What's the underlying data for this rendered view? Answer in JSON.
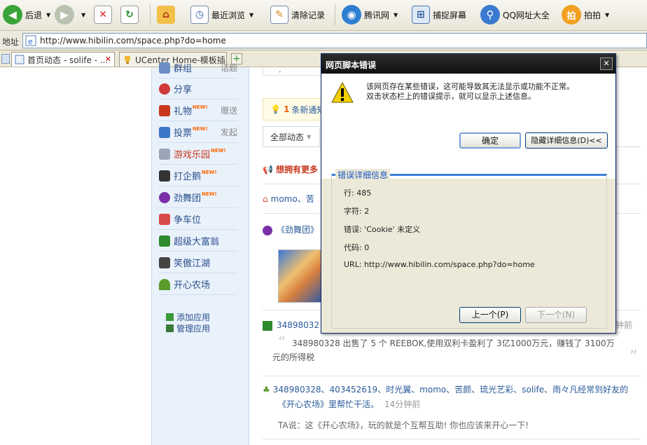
{
  "toolbar": {
    "back": "后退",
    "recent": "最近浏览",
    "clear": "清除记录",
    "tencent": "腾讯网",
    "capture": "捕捉屏幕",
    "qq_urls": "QQ网址大全",
    "paipai": "拍拍"
  },
  "address": {
    "label": "地址",
    "url": "http://www.hibilin.com/space.php?do=home"
  },
  "tabs": [
    {
      "title": "首页动态 - solife - ..."
    },
    {
      "title": "UCenter Home-模板插..."
    }
  ],
  "sidebar": {
    "items": [
      {
        "label": "群组",
        "side": "话题",
        "new": "",
        "color": "#2a4e8a",
        "icon_color": "#6b8fc4"
      },
      {
        "label": "分享",
        "side": "",
        "new": "",
        "color": "#2a4e8a",
        "icon_color": "#d03a3a"
      },
      {
        "label": "礼物",
        "side": "赠送",
        "new": "NEW!",
        "color": "#2a4e8a",
        "icon_color": "#c8381d"
      },
      {
        "label": "投票",
        "side": "发起",
        "new": "NEW!",
        "color": "#2a4e8a",
        "icon_color": "#3c78c8"
      },
      {
        "label": "游戏乐园",
        "side": "",
        "new": "NEW!",
        "color": "#c8381d",
        "icon_color": "#9aa6b8"
      },
      {
        "label": "打企鹅",
        "side": "",
        "new": "NEW!",
        "color": "#2a4e8a",
        "icon_color": "#333333"
      },
      {
        "label": "劲舞团",
        "side": "",
        "new": "NEW!",
        "color": "#2a4e8a",
        "icon_color": "#7a2fa8"
      },
      {
        "label": "争车位",
        "side": "",
        "new": "",
        "color": "#2a4e8a",
        "icon_color": "#d84a4a"
      },
      {
        "label": "超级大富翁",
        "side": "",
        "new": "",
        "color": "#2a4e8a",
        "icon_color": "#2e8a2e"
      },
      {
        "label": "笑傲江湖",
        "side": "",
        "new": "",
        "color": "#2a4e8a",
        "icon_color": "#444444"
      },
      {
        "label": "开心农场",
        "side": "",
        "new": "",
        "color": "#2a4e8a",
        "icon_color": "#5a9a2a"
      }
    ],
    "add_app": "添加应用",
    "manage_app": "管理应用"
  },
  "main": {
    "notice_count": "1",
    "notice_text": "条新通知",
    "filter_tab": "全部动态",
    "promo": "想拥有更多",
    "feed1_users": "momo、苦",
    "feed2_title": "《劲舞团》",
    "feed3_user": "34898032",
    "feed3_time": "钟前",
    "feed3_quote": "348980328 出售了 5 个 REEBOK,使用双利卡盈利了 3亿1000万元，赚钱了 3100万",
    "feed3_quote2": "元的所得税",
    "feed4_line1": "348980328、403452619、时光翼、momo、苦颜、琉光艺彩、solife、雨々凡经常到好友的",
    "feed4_line2a": "《开心农场》里帮忙干活。",
    "feed4_time": "14分钟前",
    "feed4_tip": "TA说：这《开心农场》，玩的就是个互帮互助! 你也应该来开心一下!"
  },
  "dialog": {
    "title": "网页脚本错误",
    "close": "✕",
    "message1": "该网页存在某些错误，这可能导致其无法显示或功能不正常。",
    "message2": "双击状态栏上的错误提示，就可以显示上述信息。",
    "ok": "确定",
    "hide_details": "隐藏详细信息(D)<<",
    "group_label": "错误详细信息",
    "line": "行: 485",
    "char": "字符: 2",
    "error": "错误: 'Cookie' 未定义",
    "code": "代码: 0",
    "url": "URL: http://www.hibilin.com/space.php?do=home",
    "prev": "上一个(P)",
    "next": "下一个(N)"
  }
}
